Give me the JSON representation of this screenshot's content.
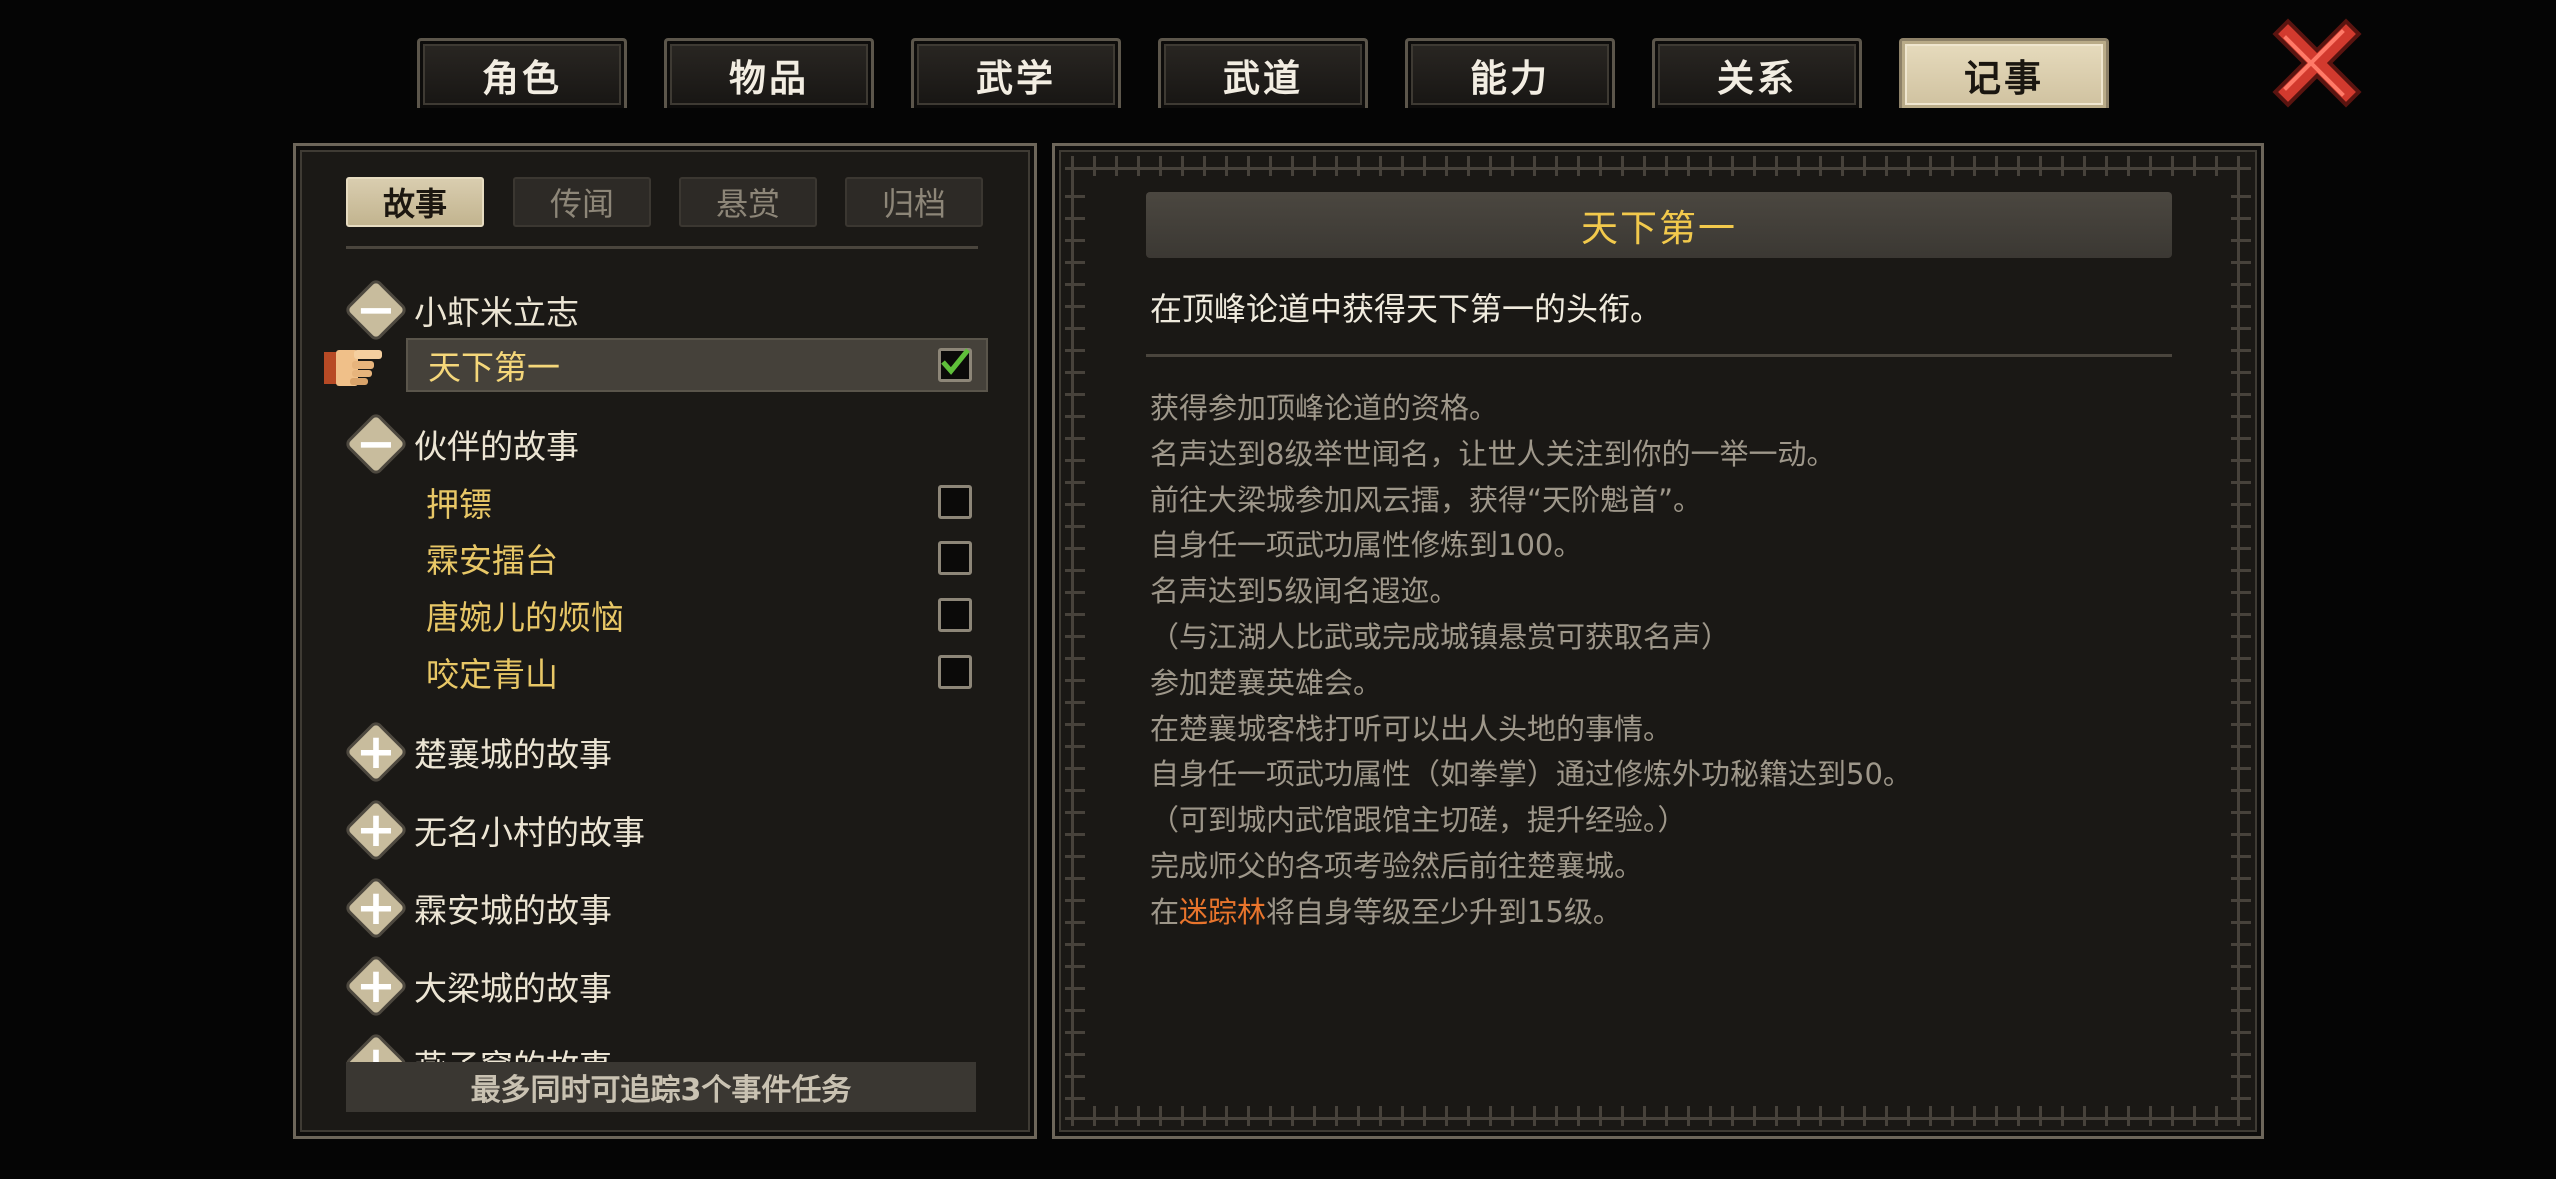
{
  "tabs": [
    {
      "label": "角色"
    },
    {
      "label": "物品"
    },
    {
      "label": "武学"
    },
    {
      "label": "武道"
    },
    {
      "label": "能力"
    },
    {
      "label": "关系"
    },
    {
      "label": "记事",
      "active": true
    }
  ],
  "close_icon": "close-x-icon",
  "subtabs": [
    {
      "label": "故事",
      "active": true
    },
    {
      "label": "传闻"
    },
    {
      "label": "悬赏"
    },
    {
      "label": "归档"
    }
  ],
  "categories": [
    {
      "label": "小虾米立志",
      "expanded": true
    },
    {
      "label": "伙伴的故事",
      "expanded": true
    },
    {
      "label": "楚襄城的故事",
      "expanded": false
    },
    {
      "label": "无名小村的故事",
      "expanded": false
    },
    {
      "label": "霖安城的故事",
      "expanded": false
    },
    {
      "label": "大梁城的故事",
      "expanded": false
    },
    {
      "label": "燕子窝的故事",
      "expanded": false
    }
  ],
  "quests": [
    {
      "label": "天下第一",
      "checked": true,
      "selected": true
    },
    {
      "label": "押镖",
      "checked": false
    },
    {
      "label": "霖安擂台",
      "checked": false
    },
    {
      "label": "唐婉儿的烦恼",
      "checked": false
    },
    {
      "label": "咬定青山",
      "checked": false
    }
  ],
  "track_note": "最多同时可追踪3个事件任务",
  "detail": {
    "title": "天下第一",
    "description": "在顶峰论道中获得天下第一的头衔。",
    "requirements": [
      "获得参加顶峰论道的资格。",
      "名声达到8级举世闻名，让世人关注到你的一举一动。",
      "前往大梁城参加风云擂，获得“天阶魁首”。",
      "自身任一项武功属性修炼到100。",
      "名声达到5级闻名遐迩。",
      "（与江湖人比武或完成城镇悬赏可获取名声）",
      "参加楚襄英雄会。",
      "在楚襄城客栈打听可以出人头地的事情。",
      "自身任一项武功属性（如拳掌）通过修炼外功秘籍达到50。",
      "（可到城内武馆跟馆主切磋，提升经验。）",
      "完成师父的各项考验然后前往楚襄城。"
    ],
    "last_req": {
      "prefix": "在",
      "highlight": "迷踪林",
      "suffix": "将自身等级至少升到15级。"
    }
  },
  "colors": {
    "highlight_orange": "#e8742c",
    "quest_gold": "#e8c766",
    "title_gold": "#f2c94c",
    "check_green": "#5fbf3a",
    "close_red": "#d23a2e"
  }
}
